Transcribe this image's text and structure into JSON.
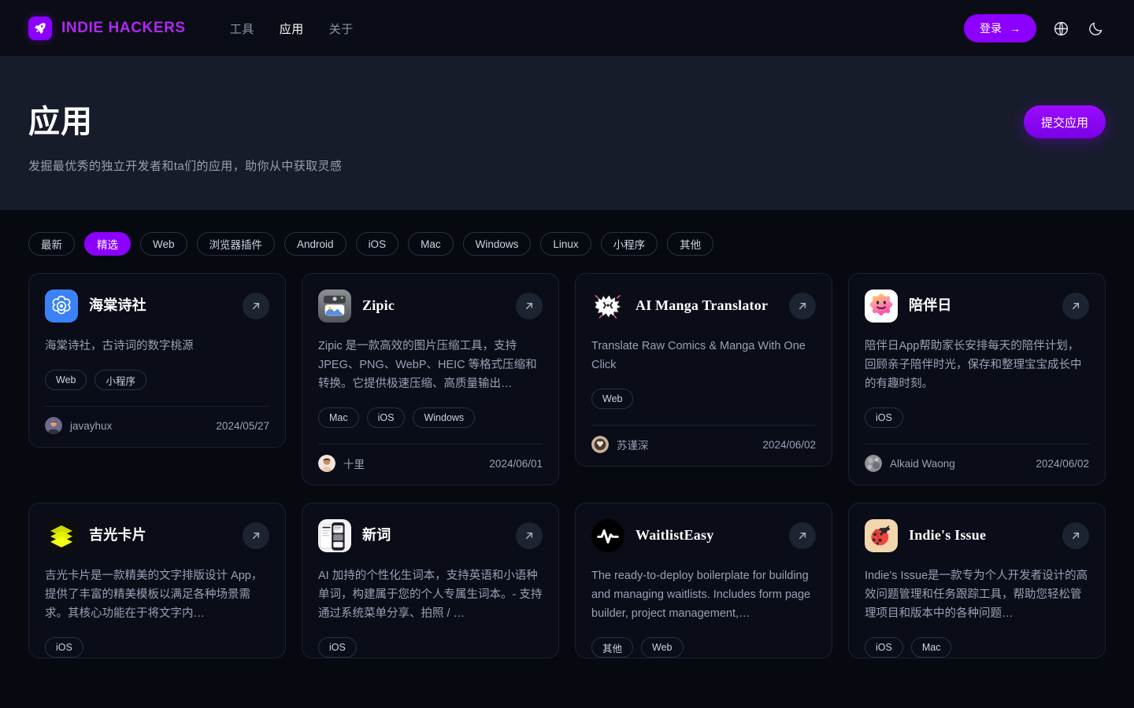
{
  "header": {
    "brand": "INDIE HACKERS",
    "logo_icon": "rocket-icon",
    "nav": [
      {
        "label": "工具",
        "active": false
      },
      {
        "label": "应用",
        "active": true
      },
      {
        "label": "关于",
        "active": false
      }
    ],
    "login_label": "登录",
    "login_arrow": "→",
    "language_icon": "globe-icon",
    "theme_icon": "moon-icon",
    "accent_color": "#8b00ff"
  },
  "hero": {
    "title": "应用",
    "subtitle": "发掘最优秀的独立开发者和ta们的应用，助你从中获取灵感",
    "submit_label": "提交应用",
    "background": "#171c2b"
  },
  "filters": [
    {
      "label": "最新",
      "active": false
    },
    {
      "label": "精选",
      "active": true
    },
    {
      "label": "Web",
      "active": false
    },
    {
      "label": "浏览器插件",
      "active": false
    },
    {
      "label": "Android",
      "active": false
    },
    {
      "label": "iOS",
      "active": false
    },
    {
      "label": "Mac",
      "active": false
    },
    {
      "label": "Windows",
      "active": false
    },
    {
      "label": "Linux",
      "active": false
    },
    {
      "label": "小程序",
      "active": false
    },
    {
      "label": "其他",
      "active": false
    }
  ],
  "cards": [
    {
      "name": "海棠诗社",
      "name_cjk": true,
      "icon": "blossom-icon",
      "icon_bg": "#3b82f6",
      "description": "海棠诗社，古诗词的数字桃源",
      "tags": [
        "Web",
        "小程序"
      ],
      "author": "javayhux",
      "date": "2024/05/27",
      "open_icon": "arrow-up-right-icon"
    },
    {
      "name": "Zipic",
      "name_cjk": false,
      "icon": "image-compress-icon",
      "icon_bg": "#6b6e72",
      "description": "Zipic 是一款高效的图片压缩工具，支持 JPEG、PNG、WebP、HEIC 等格式压缩和转换。它提供极速压缩、高质量输出…",
      "tags": [
        "Mac",
        "iOS",
        "Windows"
      ],
      "author": "十里",
      "date": "2024/06/01",
      "open_icon": "arrow-up-right-icon"
    },
    {
      "name": "AI Manga Translator",
      "name_cjk": false,
      "icon": "manga-burst-icon",
      "icon_bg": "transparent",
      "description": "Translate Raw Comics & Manga With One Click",
      "tags": [
        "Web"
      ],
      "author": "苏谨深",
      "date": "2024/06/02",
      "open_icon": "arrow-up-right-icon"
    },
    {
      "name": "陪伴日",
      "name_cjk": true,
      "icon": "smiley-star-icon",
      "icon_bg": "#ffffff",
      "description": "陪伴日App帮助家长安排每天的陪伴计划，回顾亲子陪伴时光，保存和整理宝宝成长中的有趣时刻。",
      "tags": [
        "iOS"
      ],
      "author": "Alkaid Waong",
      "date": "2024/06/02",
      "open_icon": "arrow-up-right-icon"
    },
    {
      "name": "吉光卡片",
      "name_cjk": true,
      "icon": "stacked-cards-icon",
      "icon_bg": "#111111",
      "description": "吉光卡片是一款精美的文字排版设计 App，提供了丰富的精美模板以满足各种场景需求。其核心功能在于将文字内…",
      "tags": [
        "iOS"
      ],
      "author": "",
      "date": "",
      "open_icon": "arrow-up-right-icon"
    },
    {
      "name": "新词",
      "name_cjk": true,
      "icon": "app-screenshot-icon",
      "icon_bg": "#f2f2f4",
      "description": "AI 加持的个性化生词本，支持英语和小语种单词，构建属于您的个人专属生词本。- 支持通过系统菜单分享、拍照 / …",
      "tags": [
        "iOS"
      ],
      "author": "",
      "date": "",
      "open_icon": "arrow-up-right-icon"
    },
    {
      "name": "WaitlistEasy",
      "name_cjk": false,
      "icon": "pulse-wave-icon",
      "icon_bg": "#000000",
      "description": "The ready-to-deploy boilerplate for building and managing waitlists. Includes form page builder, project management,…",
      "tags": [
        "其他",
        "Web"
      ],
      "author": "",
      "date": "",
      "open_icon": "arrow-up-right-icon"
    },
    {
      "name": "Indie's Issue",
      "name_cjk": false,
      "icon": "ladybug-icon",
      "icon_bg": "#f0d5ad",
      "description": "Indie's Issue是一款专为个人开发者设计的高效问题管理和任务跟踪工具，帮助您轻松管理项目和版本中的各种问题…",
      "tags": [
        "iOS",
        "Mac"
      ],
      "author": "",
      "date": "",
      "open_icon": "arrow-up-right-icon"
    }
  ]
}
